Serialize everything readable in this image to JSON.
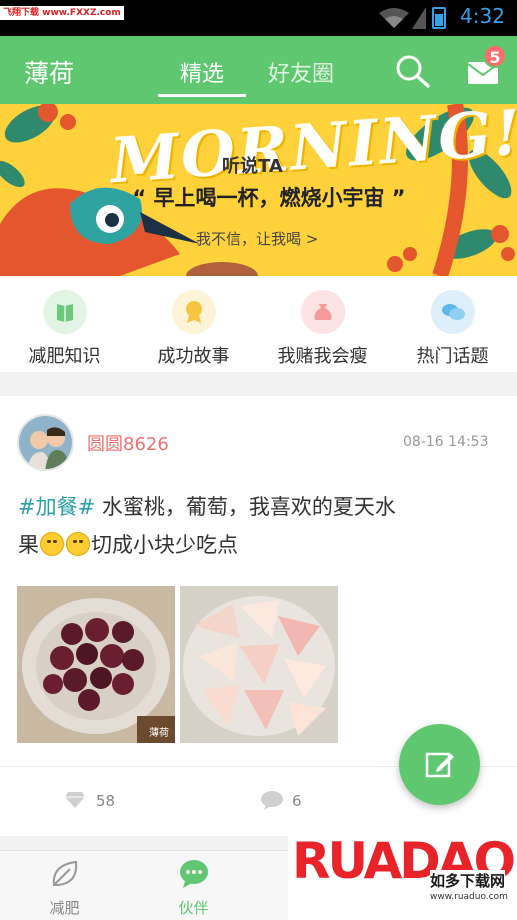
{
  "status_bar": {
    "watermark": "飞翔下载 www.FXXZ.com",
    "time": "4:32"
  },
  "header": {
    "app_title": "薄荷",
    "tabs": [
      {
        "label": "精选",
        "active": true
      },
      {
        "label": "好友圈",
        "active": false
      }
    ],
    "mail_badge": "5"
  },
  "banner": {
    "headline": "MORNING!",
    "subtitle": "听说TA",
    "quote": "“ 早上喝一杯，燃烧小宇宙 ”",
    "cta": "我不信，让我喝 >"
  },
  "categories": [
    {
      "label": "减肥知识",
      "icon": "book-icon",
      "color": "#6cc97a",
      "bg": "#e2f5e5"
    },
    {
      "label": "成功故事",
      "icon": "medal-icon",
      "color": "#f5c542",
      "bg": "#fdf3d6"
    },
    {
      "label": "我赌我会瘦",
      "icon": "money-bag-icon",
      "color": "#f59a9a",
      "bg": "#fde3e3"
    },
    {
      "label": "热门话题",
      "icon": "chat-bubbles-icon",
      "color": "#5bb8e8",
      "bg": "#ddf0fa"
    }
  ],
  "post": {
    "username": "圆圆8626",
    "timestamp": "08-16 14:53",
    "tag": "#加餐#",
    "text_line1": " 水蜜桃，葡萄，我喜欢的夏天水",
    "text_line2_start": "果",
    "text_line2_end": "切成小块少吃点",
    "image1_caption": "薄荷",
    "likes": "58",
    "comments": "6"
  },
  "bottom_nav": [
    {
      "label": "减肥",
      "icon": "leaf-icon",
      "active": false
    },
    {
      "label": "伙伴",
      "icon": "chat-icon",
      "active": true
    }
  ],
  "watermark": {
    "brand": "RUADAO",
    "site_name": "如多下载网",
    "url": "www.ruaduo.com"
  },
  "colors": {
    "primary_green": "#5fc770",
    "username_red": "#f07070",
    "tag_teal": "#2ba1a5",
    "banner_yellow": "#ffd23c"
  }
}
